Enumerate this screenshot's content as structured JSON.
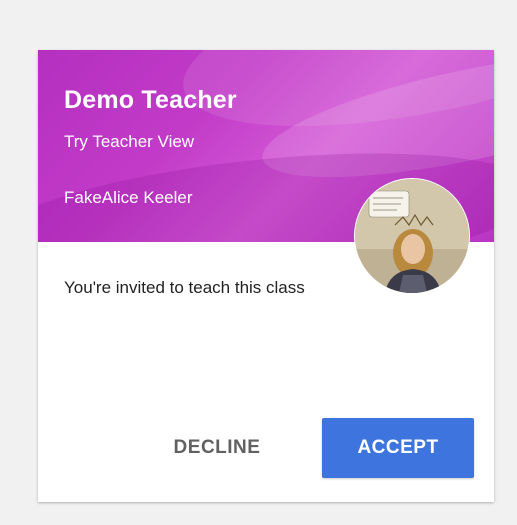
{
  "card": {
    "title": "Demo Teacher",
    "section": "Try Teacher View",
    "owner": "FakeAlice Keeler",
    "invite_message": "You're invited to teach this class"
  },
  "actions": {
    "decline_label": "DECLINE",
    "accept_label": "ACCEPT"
  },
  "colors": {
    "banner": "#c23bc8",
    "accept": "#3d74de",
    "decline_text": "#616161",
    "page_background": "#f1f1f1"
  },
  "icons": {
    "avatar": "profile-photo-avatar"
  }
}
